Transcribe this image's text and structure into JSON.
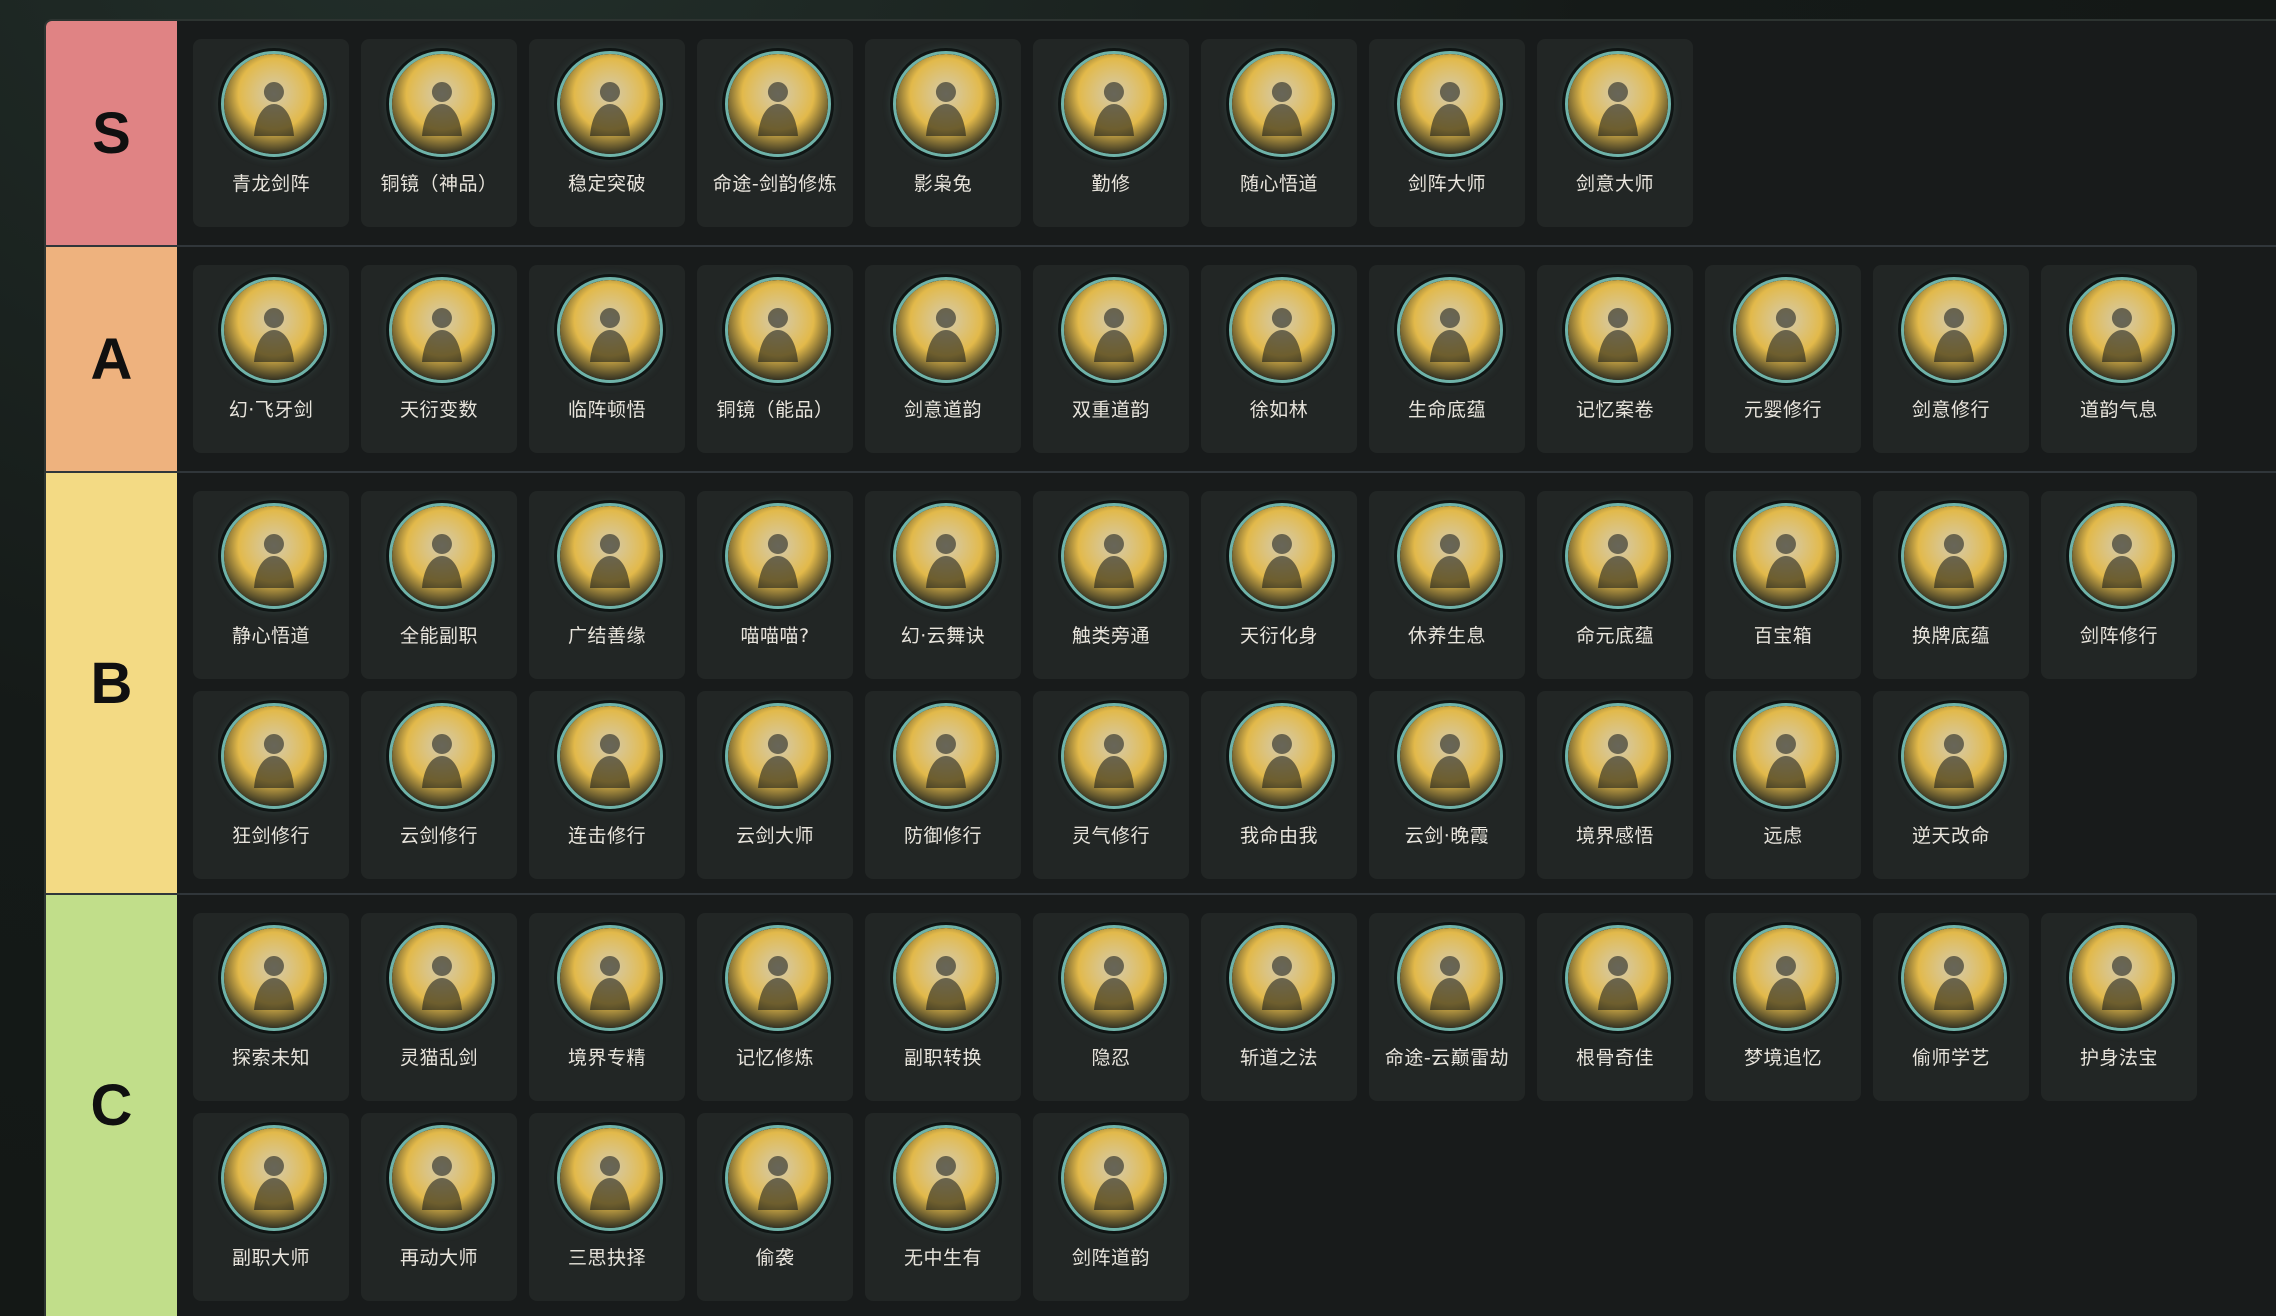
{
  "tiers": [
    {
      "label": "S",
      "color": "#e08384",
      "items": [
        {
          "name": "青龙剑阵",
          "icon": "golden-dragon-icon",
          "hue": "#e2b94a"
        },
        {
          "name": "铜镜（神品）",
          "icon": "magnifier-card-icon",
          "hue": "#d8b36a"
        },
        {
          "name": "稳定突破",
          "icon": "rising-arrow-icon",
          "hue": "#c9a36a"
        },
        {
          "name": "命途-剑韵修炼",
          "icon": "crossed-swords-icon",
          "hue": "#c98a4f"
        },
        {
          "name": "影枭兔",
          "icon": "owl-rabbit-icon",
          "hue": "#d9b24a"
        },
        {
          "name": "勤修",
          "icon": "meditation-figure-icon",
          "hue": "#c47e56"
        },
        {
          "name": "随心悟道",
          "icon": "split-arrows-icon",
          "hue": "#8a7bc9"
        },
        {
          "name": "剑阵大师",
          "icon": "sword-formation-silhouette-icon",
          "hue": "#3f5a8a"
        },
        {
          "name": "剑意大师",
          "icon": "sword-intent-silhouette-icon",
          "hue": "#4a3f7a"
        }
      ]
    },
    {
      "label": "A",
      "color": "#eeb27e",
      "items": [
        {
          "name": "幻·飞牙剑",
          "icon": "red-blades-icon",
          "hue": "#c99a6a"
        },
        {
          "name": "天衍变数",
          "icon": "cards-icon",
          "hue": "#5a7aa0"
        },
        {
          "name": "临阵顿悟",
          "icon": "radiant-meditation-icon",
          "hue": "#b8855a"
        },
        {
          "name": "铜镜（能品）",
          "icon": "blue-magnifier-card-icon",
          "hue": "#4a7ab0"
        },
        {
          "name": "剑意道韵",
          "icon": "purple-blade-icon",
          "hue": "#6a4aa0"
        },
        {
          "name": "双重道韵",
          "icon": "twin-scrolls-icon",
          "hue": "#8a9ab0"
        },
        {
          "name": "徐如林",
          "icon": "bamboo-forest-icon",
          "hue": "#8aa08a"
        },
        {
          "name": "生命底蕴",
          "icon": "green-heart-icon",
          "hue": "#3f8a6a"
        },
        {
          "name": "记忆案卷",
          "icon": "scroll-icon",
          "hue": "#4a8ab0"
        },
        {
          "name": "元婴修行",
          "icon": "blue-silhouette-icon",
          "hue": "#4a5a9a"
        },
        {
          "name": "剑意修行",
          "icon": "golden-silhouette-icon",
          "hue": "#a06a3a"
        },
        {
          "name": "道韵气息",
          "icon": "golden-swirl-icon",
          "hue": "#a08a3a"
        }
      ]
    },
    {
      "label": "B",
      "color": "#f3da84",
      "items": [
        {
          "name": "静心悟道",
          "icon": "lotus-meditation-icon",
          "hue": "#5a7a5a"
        },
        {
          "name": "全能副职",
          "icon": "multi-card-figure-icon",
          "hue": "#7a5a4a"
        },
        {
          "name": "广结善缘",
          "icon": "juggling-figure-icon",
          "hue": "#4a7a7a"
        },
        {
          "name": "喵喵喵?",
          "icon": "cat-icon",
          "hue": "#c08a6a"
        },
        {
          "name": "幻·云舞诀",
          "icon": "dancing-swordsman-icon",
          "hue": "#d0b060"
        },
        {
          "name": "触类旁通",
          "icon": "purple-banner-icon",
          "hue": "#5a3aa0"
        },
        {
          "name": "天衍化身",
          "icon": "azure-avatar-icon",
          "hue": "#3a6a8a"
        },
        {
          "name": "休养生息",
          "icon": "resting-figure-icon",
          "hue": "#5a3a8a"
        },
        {
          "name": "命元底蕴",
          "icon": "heart-plus-eight-icon",
          "hue": "#4a8a7a"
        },
        {
          "name": "百宝箱",
          "icon": "treasure-chest-icon",
          "hue": "#b09a7a"
        },
        {
          "name": "换牌底蕴",
          "icon": "green-cards-icon",
          "hue": "#6a9a5a"
        },
        {
          "name": "剑阵修行",
          "icon": "sword-formation-training-icon",
          "hue": "#3a5a8a"
        },
        {
          "name": "狂剑修行",
          "icon": "frenzy-sword-icon",
          "hue": "#5a3a2a"
        },
        {
          "name": "云剑修行",
          "icon": "cloud-sword-icon",
          "hue": "#3a6a7a"
        },
        {
          "name": "连击修行",
          "icon": "combo-strike-icon",
          "hue": "#3a4a6a"
        },
        {
          "name": "云剑大师",
          "icon": "cloud-sword-master-icon",
          "hue": "#5a4a4a"
        },
        {
          "name": "防御修行",
          "icon": "shield-figure-icon",
          "hue": "#3a4a6a"
        },
        {
          "name": "灵气修行",
          "icon": "blue-flame-figure-icon",
          "hue": "#2a4a7a"
        },
        {
          "name": "我命由我",
          "icon": "cycle-arrows-icon",
          "hue": "#a08a5a"
        },
        {
          "name": "云剑·晚霞",
          "icon": "violet-sword-icon",
          "hue": "#a04ab0"
        },
        {
          "name": "境界感悟",
          "icon": "rainbow-fan-icon",
          "hue": "#8a7a5a"
        },
        {
          "name": "远虑",
          "icon": "violet-meditation-icon",
          "hue": "#4a2a7a"
        },
        {
          "name": "逆天改命",
          "icon": "fiery-figures-icon",
          "hue": "#c06a3a"
        }
      ]
    },
    {
      "label": "C",
      "color": "#c1de8a",
      "items": [
        {
          "name": "探索未知",
          "icon": "question-cards-icon",
          "hue": "#3a5a8a"
        },
        {
          "name": "灵猫乱剑",
          "icon": "spirit-cat-icon",
          "hue": "#3a4aa0"
        },
        {
          "name": "境界专精",
          "icon": "focused-figure-icon",
          "hue": "#2a3a5a"
        },
        {
          "name": "记忆修炼",
          "icon": "brain-figure-icon",
          "hue": "#2a4a7a"
        },
        {
          "name": "副职转换",
          "icon": "gears-icon",
          "hue": "#7a5a3a"
        },
        {
          "name": "隐忍",
          "icon": "web-figure-icon",
          "hue": "#3a4a6a"
        },
        {
          "name": "斩道之法",
          "icon": "tree-blade-icon",
          "hue": "#5a4a3a"
        },
        {
          "name": "命途-云巅雷劫",
          "icon": "thunder-hero-icon",
          "hue": "#4a3a6a"
        },
        {
          "name": "根骨奇佳",
          "icon": "spine-figure-icon",
          "hue": "#7a4a3a"
        },
        {
          "name": "梦境追忆",
          "icon": "dream-orb-icon",
          "hue": "#6a4a9a"
        },
        {
          "name": "偷师学艺",
          "icon": "peeking-figure-icon",
          "hue": "#5a3a2a"
        },
        {
          "name": "护身法宝",
          "icon": "treasure-altar-icon",
          "hue": "#8a4a2a"
        },
        {
          "name": "副职大师",
          "icon": "golden-master-icon",
          "hue": "#4a3a2a"
        },
        {
          "name": "再动大师",
          "icon": "dash-figure-icon",
          "hue": "#2a3a5a"
        },
        {
          "name": "三思抉择",
          "icon": "diamond-choice-icon",
          "hue": "#3a6a8a"
        },
        {
          "name": "偷袭",
          "icon": "ambush-figure-icon",
          "hue": "#5a2a2a"
        },
        {
          "name": "无中生有",
          "icon": "purple-void-icon",
          "hue": "#5a4a8a"
        },
        {
          "name": "剑阵道韵",
          "icon": "golden-sword-ring-icon",
          "hue": "#c0a03a"
        }
      ]
    }
  ]
}
